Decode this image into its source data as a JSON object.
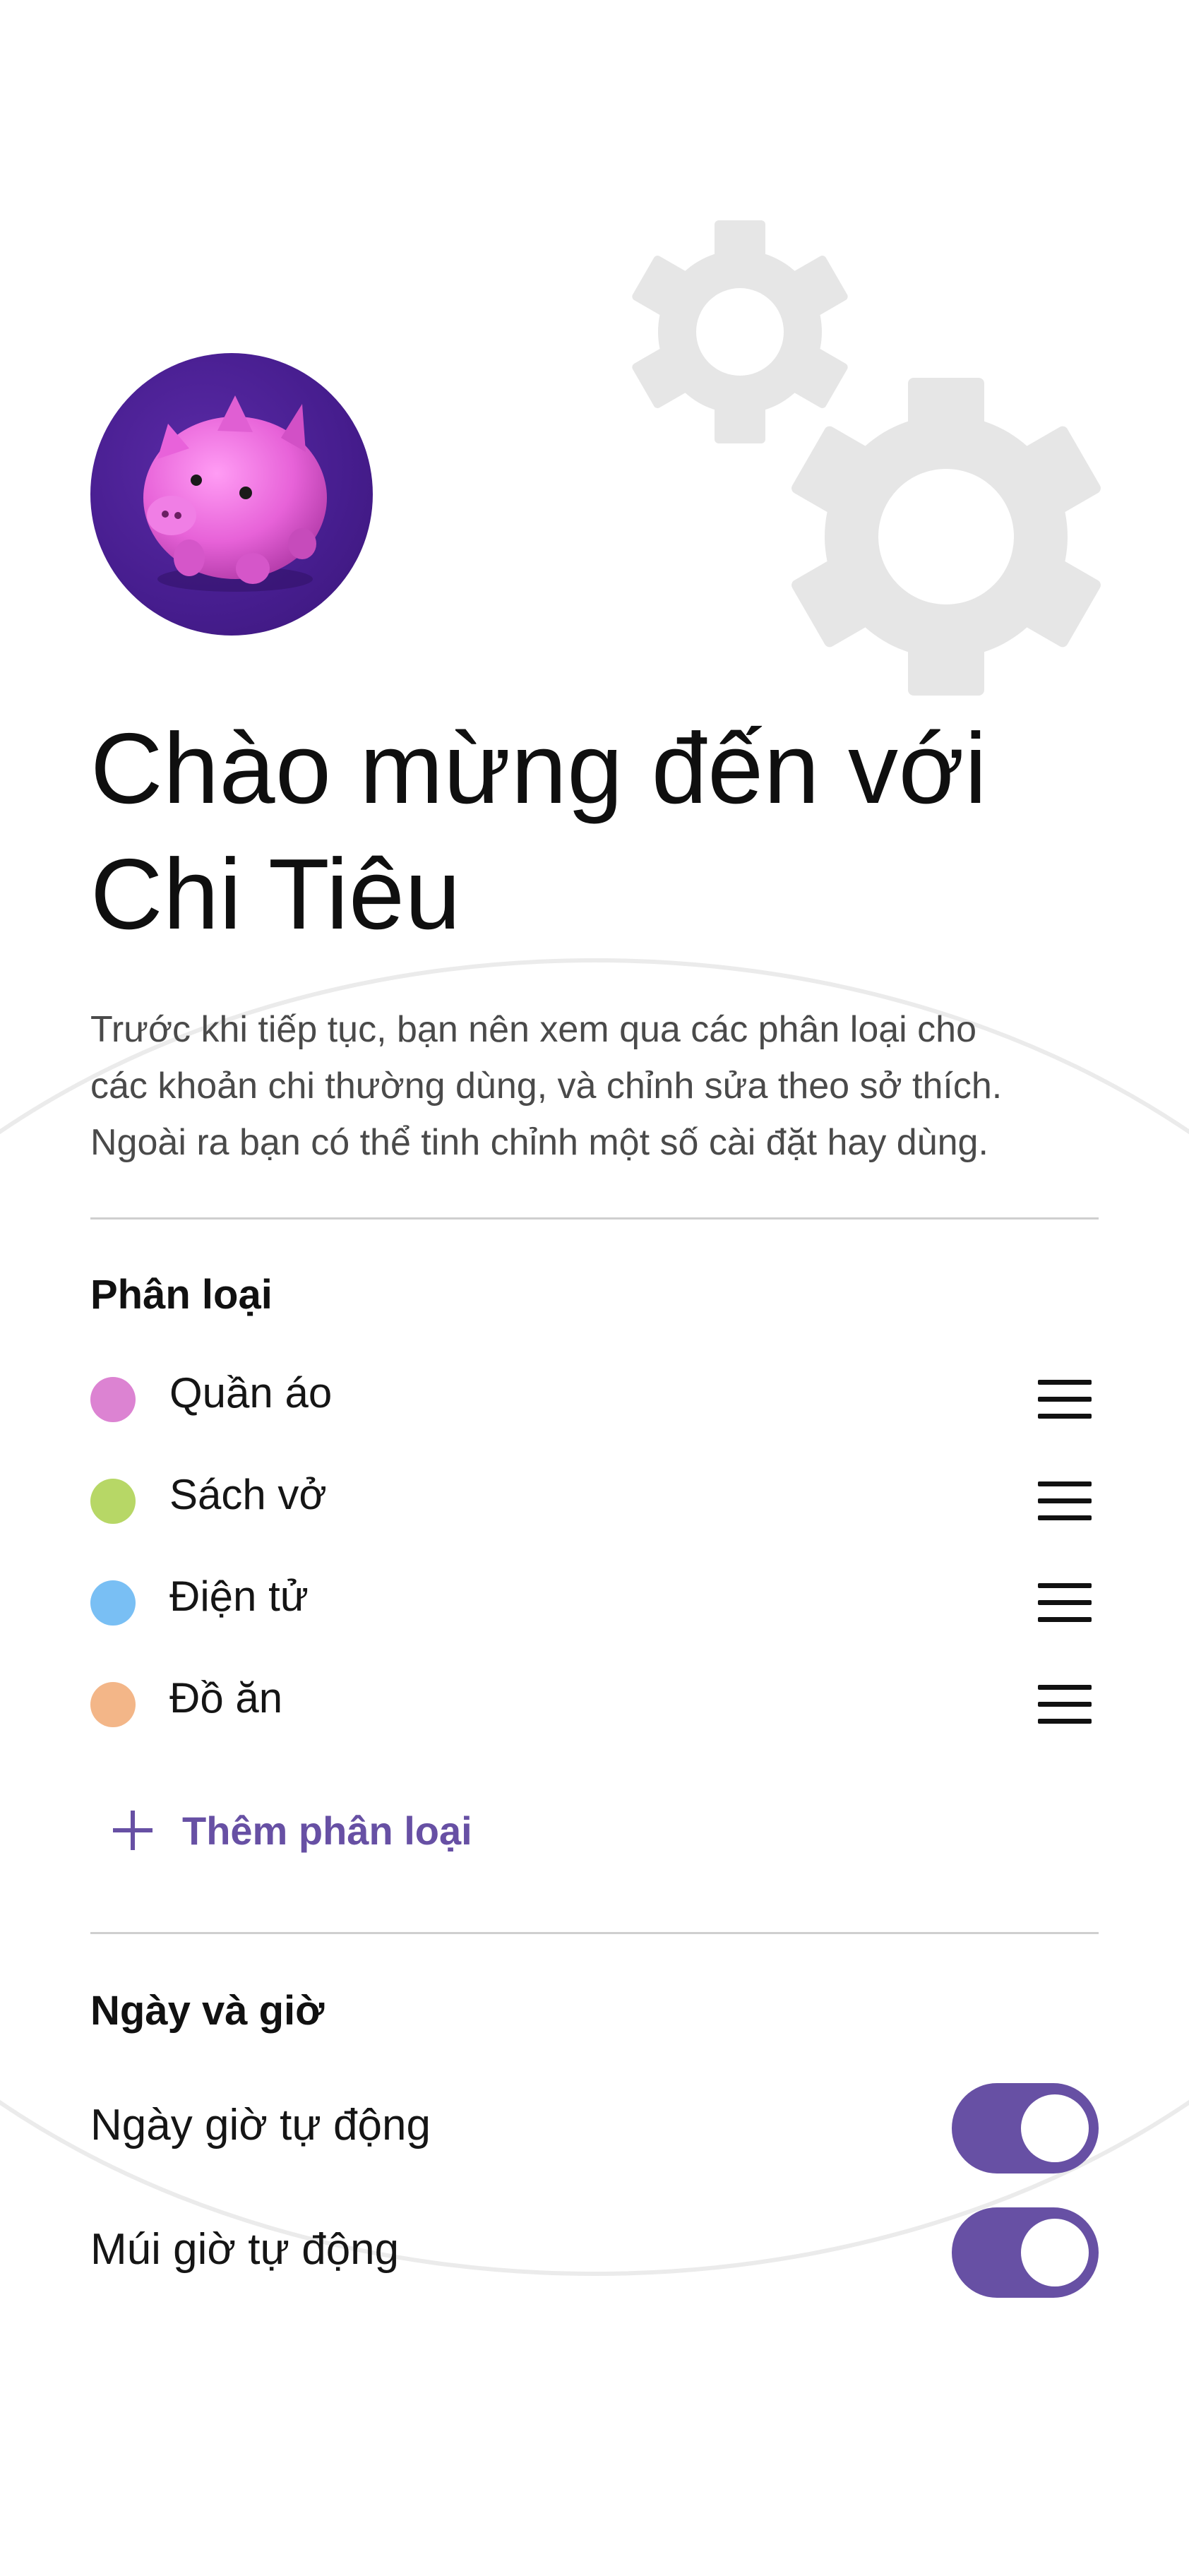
{
  "welcome": {
    "title_line1": "Chào mừng đến với",
    "title_line2": "Chi Tiêu",
    "intro_line1": "Trước khi tiếp tục, bạn nên xem qua các phân loại cho",
    "intro_line2": "các khoản chi thường dùng, và chỉnh sửa theo sở thích.",
    "intro_line3": "Ngoài ra bạn có thể tinh chỉnh một số cài đặt hay dùng."
  },
  "categories": {
    "title": "Phân loại",
    "items": [
      {
        "label": "Quần áo",
        "color": "#dc83d2"
      },
      {
        "label": "Sách vở",
        "color": "#b7d766"
      },
      {
        "label": "Điện tử",
        "color": "#79bff4"
      },
      {
        "label": "Đồ ăn",
        "color": "#f3b688"
      }
    ],
    "add_label": "Thêm phân loại"
  },
  "datetime": {
    "title": "Ngày và giờ",
    "auto_datetime_label": "Ngày giờ tự động",
    "auto_datetime_enabled": true,
    "auto_timezone_label": "Múi giờ tự động",
    "auto_timezone_enabled": true
  },
  "colors": {
    "accent": "#6750a4",
    "avatar_bg": "#461d8e",
    "decoration_gray": "#e6e6e6"
  },
  "icons": [
    "piggy-bank-icon",
    "gear-icon",
    "drag-handle-icon",
    "plus-icon"
  ]
}
